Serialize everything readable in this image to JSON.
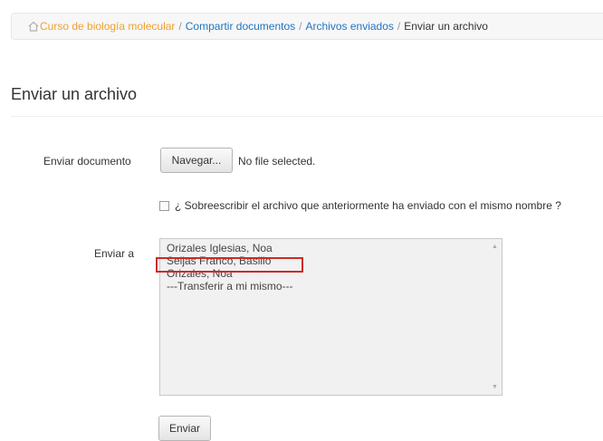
{
  "breadcrumb": {
    "items": [
      {
        "label": "Curso de biología molecular",
        "color": "#f0a030"
      },
      {
        "label": "Compartir documentos",
        "color": "#1f76c2"
      },
      {
        "label": "Archivos enviados",
        "color": "#1f76c2"
      }
    ],
    "current": "Enviar un archivo",
    "separator": "/",
    "icon": "home-icon"
  },
  "page": {
    "title": "Enviar un archivo"
  },
  "form": {
    "document_label": "Enviar documento",
    "browse_label": "Navegar...",
    "file_status": "No file selected.",
    "overwrite_checked": false,
    "overwrite_label": "¿ Sobreescribir el archivo que anteriormente ha enviado con el mismo nombre ?",
    "send_to_label": "Enviar a",
    "recipients": [
      "Orizales Iglesias, Noa",
      "Seijas Franco, Basilio",
      "Orizales, Noa",
      "---Transferir a mi mismo---"
    ],
    "highlighted_recipient_index": 1,
    "highlight_color": "#cc2a2a",
    "submit_label": "Enviar"
  }
}
